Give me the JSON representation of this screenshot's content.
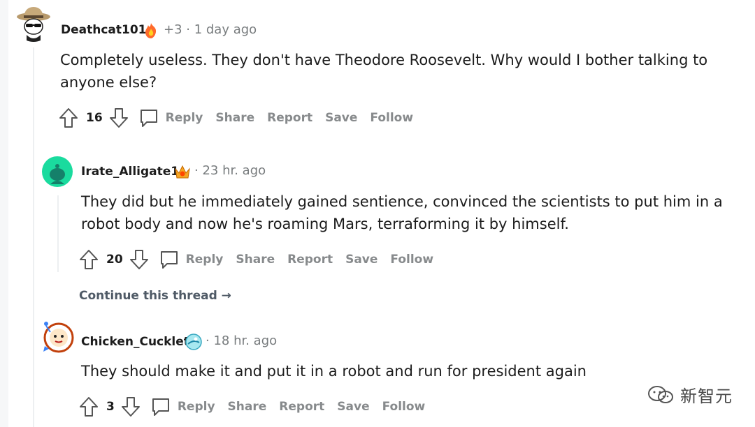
{
  "comments": [
    {
      "username": "Deathcat101",
      "meta": "+3 · 1 day ago",
      "body": "Completely useless. They don't have Theodore Roosevelt. Why would I bother talking to anyone else?",
      "votes": "16",
      "actions": [
        "Reply",
        "Share",
        "Report",
        "Save",
        "Follow"
      ]
    },
    {
      "username": "Irate_Alligate1",
      "meta": "· 23 hr. ago",
      "body": "They did but he immediately gained sentience, convinced the scientists to put him in a robot body and now he's roaming Mars, terraforming it by himself.",
      "votes": "20",
      "actions": [
        "Reply",
        "Share",
        "Report",
        "Save",
        "Follow"
      ],
      "continue_link": "Continue this thread →"
    },
    {
      "username": "Chicken_Cucklet",
      "meta": "· 18 hr. ago",
      "body": "They should make it and put it in a robot and run for president again",
      "votes": "3",
      "actions": [
        "Reply",
        "Share",
        "Report",
        "Save",
        "Follow"
      ]
    }
  ],
  "watermark": {
    "text": "新智元"
  },
  "colors": {
    "action_gray": "#878a8c",
    "meta_gray": "#787c7e",
    "link_slate": "#4f5a66",
    "thread_line": "#edeff1"
  }
}
